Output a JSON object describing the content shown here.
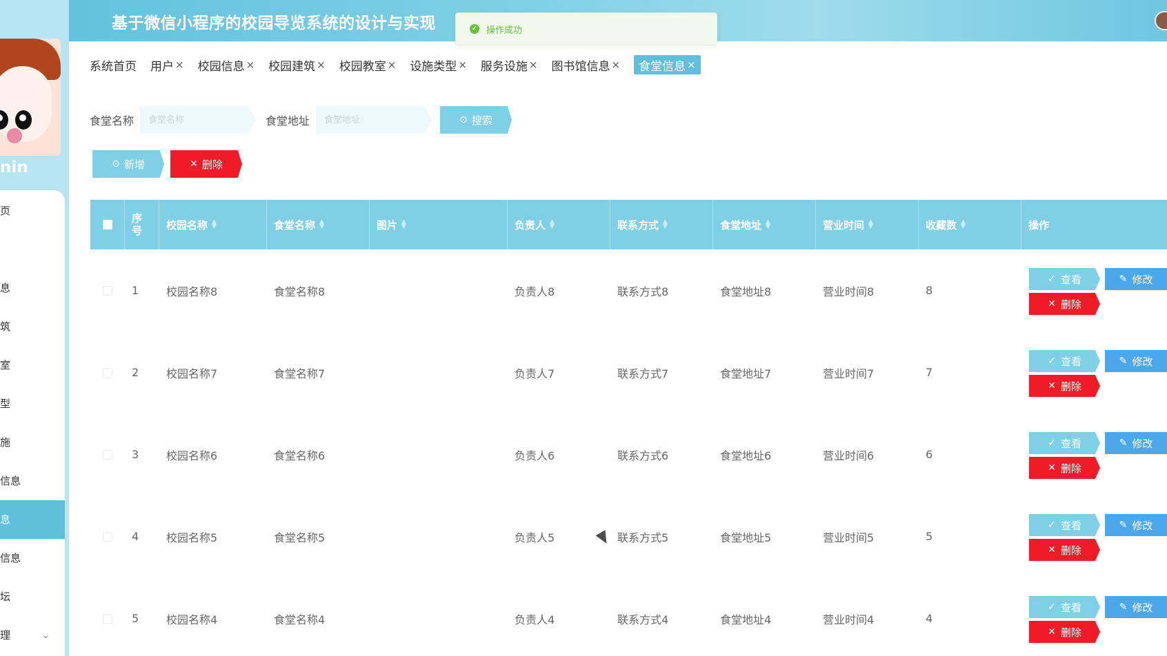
{
  "header": {
    "title": "基于微信小程序的校园导览系统的设计与实现",
    "toast": "操作成功"
  },
  "sidebar": {
    "username": "nin",
    "items": [
      {
        "label": "页"
      },
      {
        "label": "息"
      },
      {
        "label": "筑"
      },
      {
        "label": "室"
      },
      {
        "label": "型"
      },
      {
        "label": "施"
      },
      {
        "label": "信息"
      },
      {
        "label": "息"
      },
      {
        "label": "信息"
      },
      {
        "label": "坛"
      },
      {
        "label": "理"
      }
    ]
  },
  "tabs": [
    {
      "label": "系统首页",
      "closable": false
    },
    {
      "label": "用户",
      "closable": true
    },
    {
      "label": "校园信息",
      "closable": true
    },
    {
      "label": "校园建筑",
      "closable": true
    },
    {
      "label": "校园教室",
      "closable": true
    },
    {
      "label": "设施类型",
      "closable": true
    },
    {
      "label": "服务设施",
      "closable": true
    },
    {
      "label": "图书馆信息",
      "closable": true
    },
    {
      "label": "食堂信息",
      "closable": true,
      "active": true
    }
  ],
  "tab_close_glyph": "×",
  "search": {
    "name_label": "食堂名称",
    "name_placeholder": "食堂名称",
    "address_label": "食堂地址",
    "address_placeholder": "食堂地址",
    "search_button": "搜索",
    "add_button": "新增",
    "delete_button": "删除"
  },
  "table": {
    "headers": {
      "index": "序号",
      "campus": "校园名称",
      "canteen": "食堂名称",
      "image": "图片",
      "person": "负责人",
      "contact": "联系方式",
      "address": "食堂地址",
      "hours": "营业时间",
      "favorites": "收藏数",
      "actions": "操作"
    },
    "rows": [
      {
        "index": "1",
        "campus": "校园名称8",
        "canteen": "食堂名称8",
        "person": "负责人8",
        "contact": "联系方式8",
        "address": "食堂地址8",
        "hours": "营业时间8",
        "favorites": "8"
      },
      {
        "index": "2",
        "campus": "校园名称7",
        "canteen": "食堂名称7",
        "person": "负责人7",
        "contact": "联系方式7",
        "address": "食堂地址7",
        "hours": "营业时间7",
        "favorites": "7"
      },
      {
        "index": "3",
        "campus": "校园名称6",
        "canteen": "食堂名称6",
        "person": "负责人6",
        "contact": "联系方式6",
        "address": "食堂地址6",
        "hours": "营业时间6",
        "favorites": "6"
      },
      {
        "index": "4",
        "campus": "校园名称5",
        "canteen": "食堂名称5",
        "person": "负责人5",
        "contact": "联系方式5",
        "address": "食堂地址5",
        "hours": "营业时间5",
        "favorites": "5"
      },
      {
        "index": "5",
        "campus": "校园名称4",
        "canteen": "食堂名称4",
        "person": "负责人4",
        "contact": "联系方式4",
        "address": "食堂地址4",
        "hours": "营业时间4",
        "favorites": "4"
      }
    ],
    "row_actions": {
      "view": "查看",
      "edit": "修改",
      "delete": "删除"
    }
  },
  "colors": {
    "primary": "#5fc0dc",
    "light_primary": "#7fd0e6",
    "edit_blue": "#4aa8ea",
    "danger": "#ef1c27",
    "success": "#67c23a"
  },
  "icons": {
    "toast": "check-circle-icon",
    "search": "check-circle-icon",
    "add": "check-circle-icon",
    "delete": "close-icon",
    "view": "check-icon",
    "edit": "pencil-icon",
    "sort": "sort-icon",
    "expand": "chevron-down-icon"
  }
}
